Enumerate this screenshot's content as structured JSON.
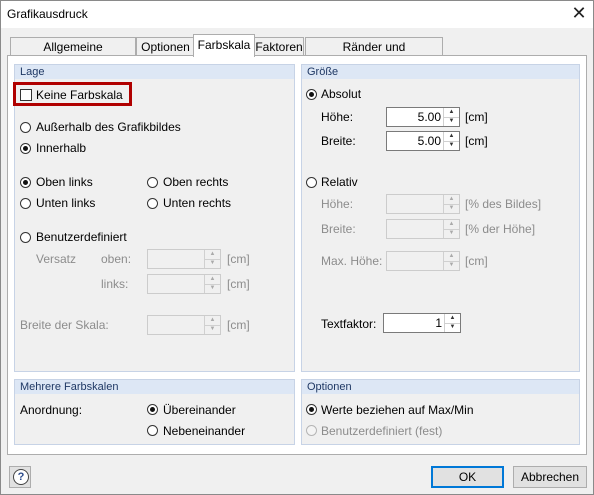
{
  "window": {
    "title": "Grafikausdruck"
  },
  "tabs": [
    {
      "label": "Allgemeine Einstellungen"
    },
    {
      "label": "Optionen"
    },
    {
      "label": "Farbskala"
    },
    {
      "label": "Faktoren"
    },
    {
      "label": "Ränder und Streckfaktoren"
    }
  ],
  "lage": {
    "title": "Lage",
    "keine_farbskala": "Keine Farbskala",
    "ausserhalb": "Außerhalb des Grafikbildes",
    "innerhalb": "Innerhalb",
    "oben_links": "Oben links",
    "oben_rechts": "Oben rechts",
    "unten_links": "Unten links",
    "unten_rechts": "Unten rechts",
    "benutzerdefiniert": "Benutzerdefiniert",
    "versatz": "Versatz",
    "oben": "oben:",
    "links": "links:",
    "breite_der_skala": "Breite der Skala:",
    "unit_cm": "[cm]"
  },
  "groesse": {
    "title": "Größe",
    "absolut": "Absolut",
    "hoehe": "Höhe:",
    "breite": "Breite:",
    "hoehe_value": "5.00",
    "breite_value": "5.00",
    "unit_cm": "[cm]",
    "relativ": "Relativ",
    "rel_hoehe": "Höhe:",
    "rel_breite": "Breite:",
    "max_hoehe": "Max. Höhe:",
    "unit_pct_bild": "[% des Bildes]",
    "unit_pct_hoehe": "[% der Höhe]",
    "textfaktor": "Textfaktor:",
    "textfaktor_value": "1"
  },
  "mehrere": {
    "title": "Mehrere Farbskalen",
    "anordnung": "Anordnung:",
    "uebereinander": "Übereinander",
    "nebeneinander": "Nebeneinander"
  },
  "optionen": {
    "title": "Optionen",
    "werte": "Werte beziehen auf Max/Min",
    "benutzerdefiniert_fest": "Benutzerdefiniert (fest)"
  },
  "footer": {
    "ok": "OK",
    "cancel": "Abbrechen",
    "help": "?"
  },
  "icons": {
    "close": "close-icon",
    "help": "help-icon",
    "spin_up": "spin-up-icon",
    "spin_down": "spin-down-icon"
  }
}
